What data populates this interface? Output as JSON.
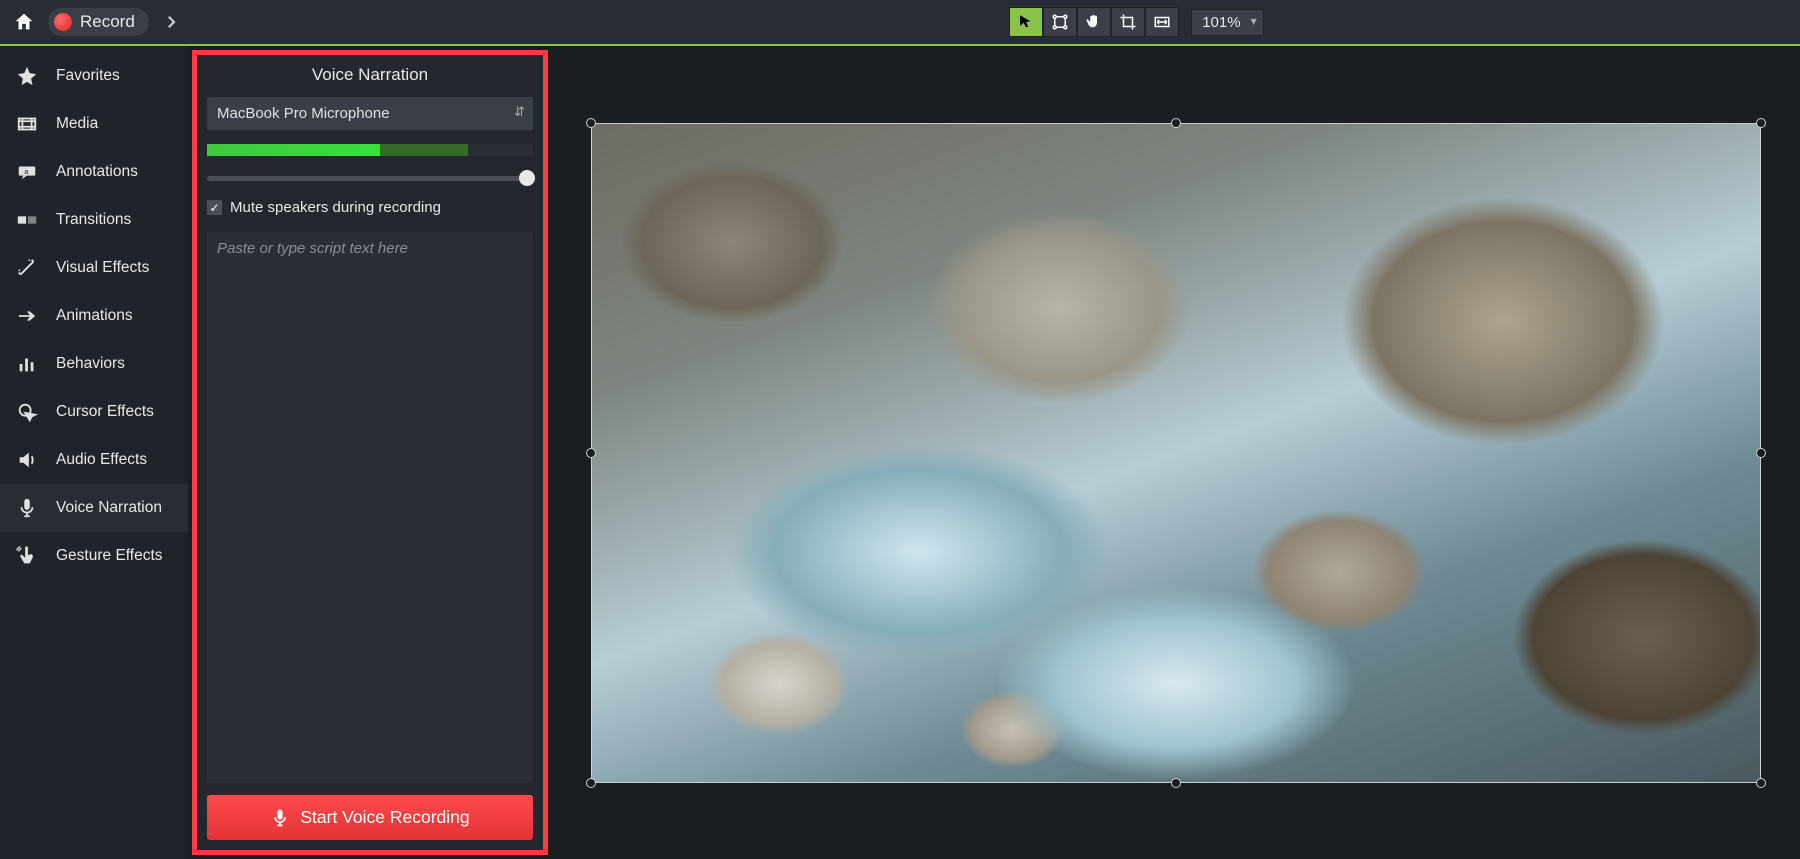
{
  "toolbar": {
    "record_label": "Record",
    "zoom_level": "101%"
  },
  "sidebar": {
    "items": [
      {
        "label": "Favorites"
      },
      {
        "label": "Media"
      },
      {
        "label": "Annotations"
      },
      {
        "label": "Transitions"
      },
      {
        "label": "Visual Effects"
      },
      {
        "label": "Animations"
      },
      {
        "label": "Behaviors"
      },
      {
        "label": "Cursor Effects"
      },
      {
        "label": "Audio Effects"
      },
      {
        "label": "Voice Narration"
      },
      {
        "label": "Gesture Effects"
      }
    ],
    "selected_index": 9
  },
  "voice_panel": {
    "title": "Voice Narration",
    "mic_selected": "MacBook Pro Microphone",
    "input_level_percent": 53,
    "gain_slider_percent": 100,
    "mute_checked": true,
    "mute_label": "Mute speakers during recording",
    "script_placeholder": "Paste or type script text here",
    "record_button_label": "Start Voice Recording"
  }
}
